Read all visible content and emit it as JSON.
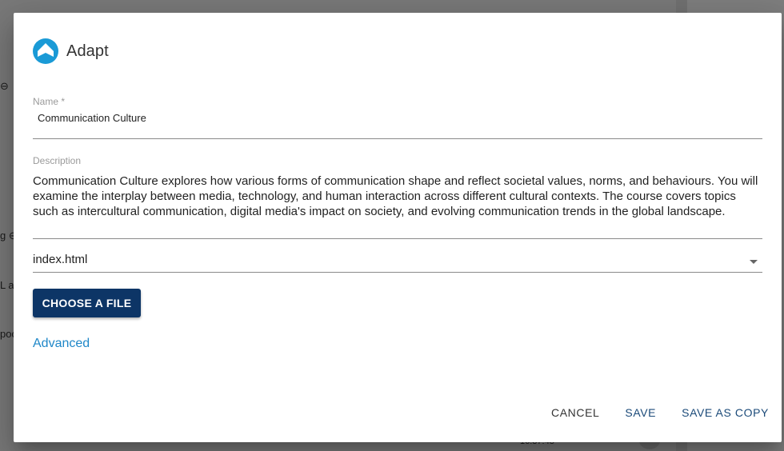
{
  "background": {
    "fragments": [
      "⊖",
      "g ⊖",
      "L a",
      "poo",
      "16:37:43"
    ]
  },
  "dialog": {
    "title": "Adapt",
    "logo_icon": "adapt-logo-icon",
    "name": {
      "label": "Name *",
      "value": "Communication Culture"
    },
    "description": {
      "label": "Description",
      "value": "Communication Culture explores how various forms of communication shape and reflect societal values, norms, and behaviours. You will examine the interplay between media, technology, and human interaction across different cultural contexts. The course covers topics such as intercultural communication, digital media's impact on society, and evolving communication trends in the global landscape."
    },
    "file_select": {
      "value": "index.html",
      "icon": "chevron-down-icon"
    },
    "choose_file_label": "CHOOSE A FILE",
    "advanced_label": "Advanced",
    "actions": {
      "cancel": "CANCEL",
      "save": "SAVE",
      "save_as_copy": "SAVE AS COPY"
    }
  },
  "colors": {
    "primary": "#0d3566",
    "link": "#1f87c8",
    "logo": "#1a9ad6",
    "action_text": "#1b4a79"
  }
}
